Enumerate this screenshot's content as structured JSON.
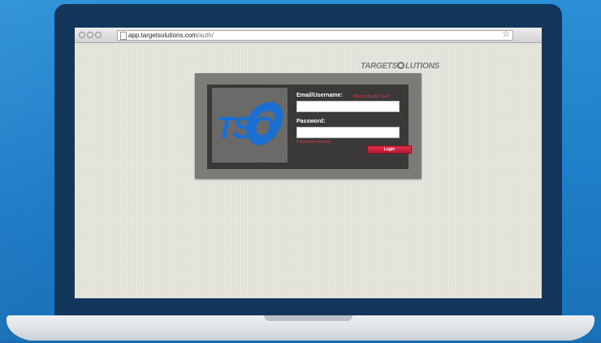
{
  "browser": {
    "url_domain": "app.targetsolutions.com",
    "url_path": "/auth/",
    "star_icon": "bookmark-star-icon"
  },
  "brand": {
    "logo_part1": "TARGET",
    "logo_part2": "S",
    "logo_part3": "LUTIONS",
    "logo_icon": "tso-logo-icon",
    "tso_text": "TSO"
  },
  "login": {
    "email_label": "Email/Username:",
    "which_link": "Which should I use?",
    "email_value": "",
    "password_label": "Password:",
    "password_value": "",
    "recovery_link": "Password recovery",
    "login_button": "Login"
  },
  "colors": {
    "background_blue": "#1d7bc6",
    "laptop_lid": "#13375a",
    "accent_red": "#e0395a",
    "tso_blue": "#1b6fd1"
  }
}
